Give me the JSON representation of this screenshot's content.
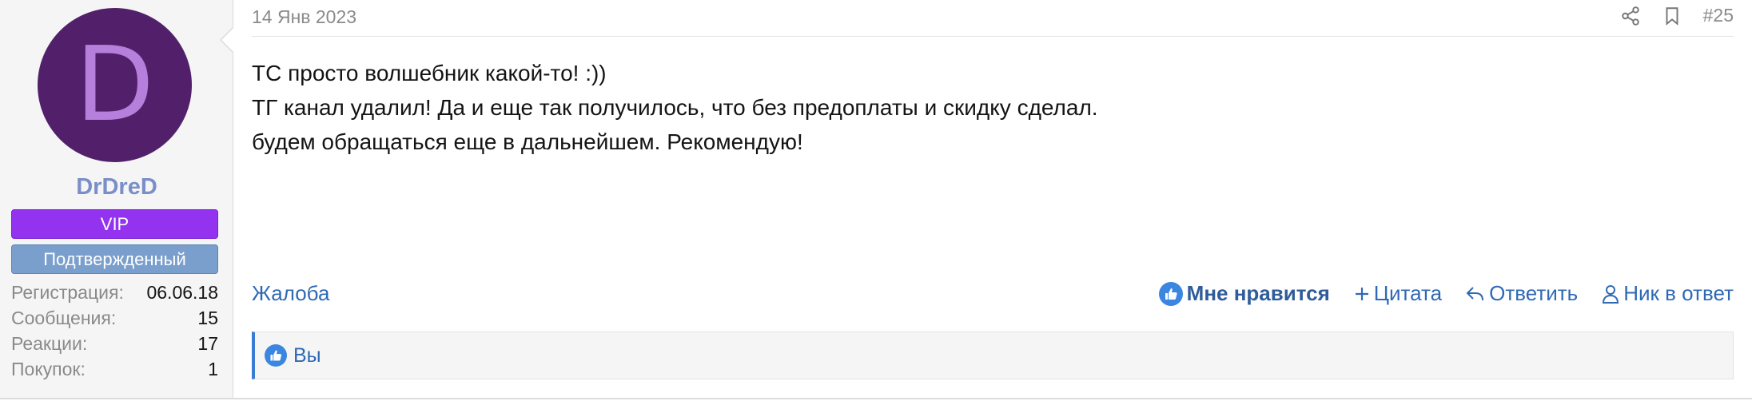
{
  "user": {
    "avatar_letter": "D",
    "avatar_bg": "#52206a",
    "avatar_fg": "#b57fdb",
    "name": "DrDreD",
    "banner_vip": "VIP",
    "banner_verified": "Подтвержденный",
    "stats": [
      {
        "label": "Регистрация:",
        "value": "06.06.18"
      },
      {
        "label": "Сообщения:",
        "value": "15"
      },
      {
        "label": "Реакции:",
        "value": "17"
      },
      {
        "label": "Покупок:",
        "value": "1"
      }
    ]
  },
  "post": {
    "date": "14 Янв 2023",
    "number": "#25",
    "message": [
      "ТС просто волшебник какой-то! :))",
      "ТГ канал удалил! Да и еще так получилось, что без предоплаты и скидку сделал.",
      "будем обращаться еще в дальнейшем. Рекомендую!"
    ]
  },
  "footer": {
    "report": "Жалоба",
    "like": "Мне нравится",
    "quote": "Цитата",
    "reply": "Ответить",
    "nick_reply": "Ник в ответ"
  },
  "reactions": {
    "users": "Вы"
  },
  "icons": {
    "share": "share-icon",
    "bookmark": "bookmark-icon",
    "like": "thumbs-up-icon",
    "quote": "plus-icon",
    "reply": "reply-arrow-icon",
    "nick": "user-icon"
  },
  "colors": {
    "link": "#2f69b5",
    "vip": "#9333f0",
    "verified": "#7a9fcc",
    "username": "#7a8fc8"
  }
}
